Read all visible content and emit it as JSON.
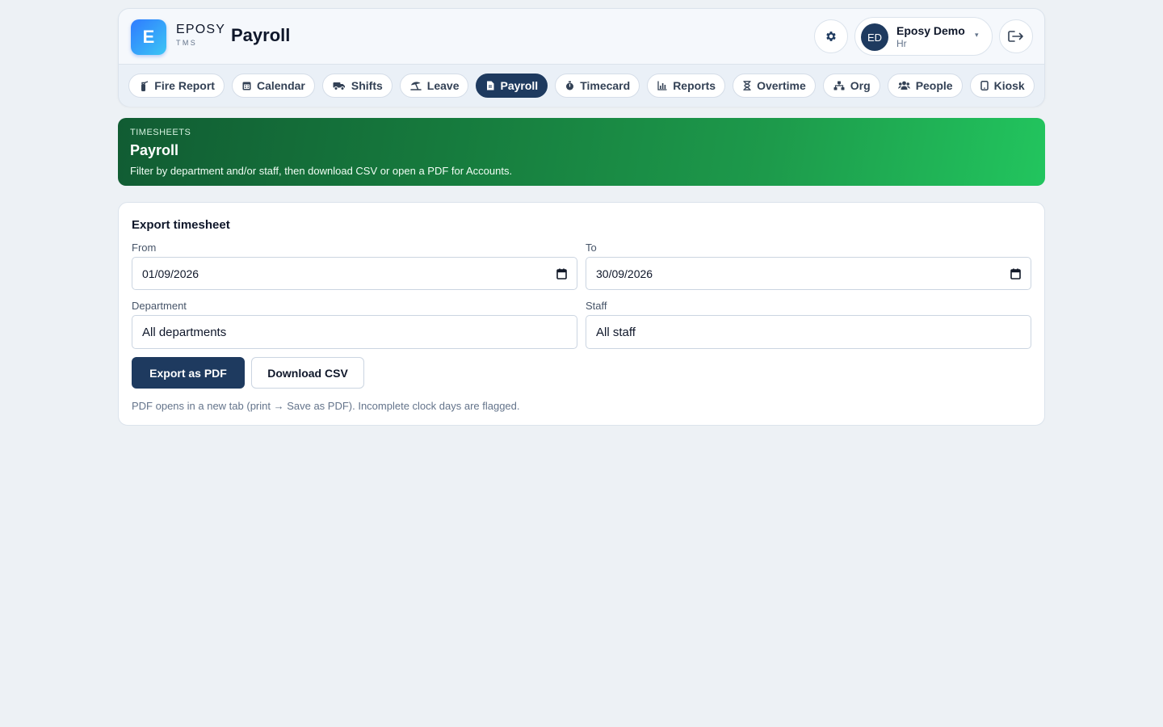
{
  "brand": {
    "logo_letter": "E",
    "name": "EPOSY",
    "sub": "TMS",
    "accent": "#2f7bff"
  },
  "header": {
    "page_title": "Payroll",
    "settings_icon": "gear-icon",
    "logout_icon": "logout-icon"
  },
  "user": {
    "initials": "ED",
    "name": "Eposy Demo",
    "role": "Hr",
    "caret": "▾"
  },
  "nav": {
    "active": "Payroll",
    "tabs": [
      {
        "label": "Fire Report",
        "icon": "fire-extinguisher-icon"
      },
      {
        "label": "Calendar",
        "icon": "calendar-icon"
      },
      {
        "label": "Shifts",
        "icon": "truck-icon"
      },
      {
        "label": "Leave",
        "icon": "umbrella-beach-icon"
      },
      {
        "label": "Payroll",
        "icon": "file-invoice-icon"
      },
      {
        "label": "Timecard",
        "icon": "stopwatch-icon"
      },
      {
        "label": "Reports",
        "icon": "bar-chart-icon"
      },
      {
        "label": "Overtime",
        "icon": "hourglass-icon"
      },
      {
        "label": "Org",
        "icon": "sitemap-icon"
      },
      {
        "label": "People",
        "icon": "users-icon"
      },
      {
        "label": "Kiosk",
        "icon": "tablet-icon"
      }
    ]
  },
  "hero": {
    "eyebrow": "TIMESHEETS",
    "title": "Payroll",
    "description": "Filter by department and/or staff, then download CSV or open a PDF for Accounts.",
    "gradient_start": "#115c33",
    "gradient_end": "#22c55e"
  },
  "export": {
    "title": "Export timesheet",
    "from_label": "From",
    "from_value": "01/09/2026",
    "to_label": "To",
    "to_value": "30/09/2026",
    "department_label": "Department",
    "department_value": "All departments",
    "staff_label": "Staff",
    "staff_value": "All staff",
    "pdf_button": "Export as PDF",
    "csv_button": "Download CSV",
    "note": "PDF opens in a new tab (print → Save as PDF). Incomplete clock days are flagged.",
    "primary_color": "#1e3a5f"
  }
}
